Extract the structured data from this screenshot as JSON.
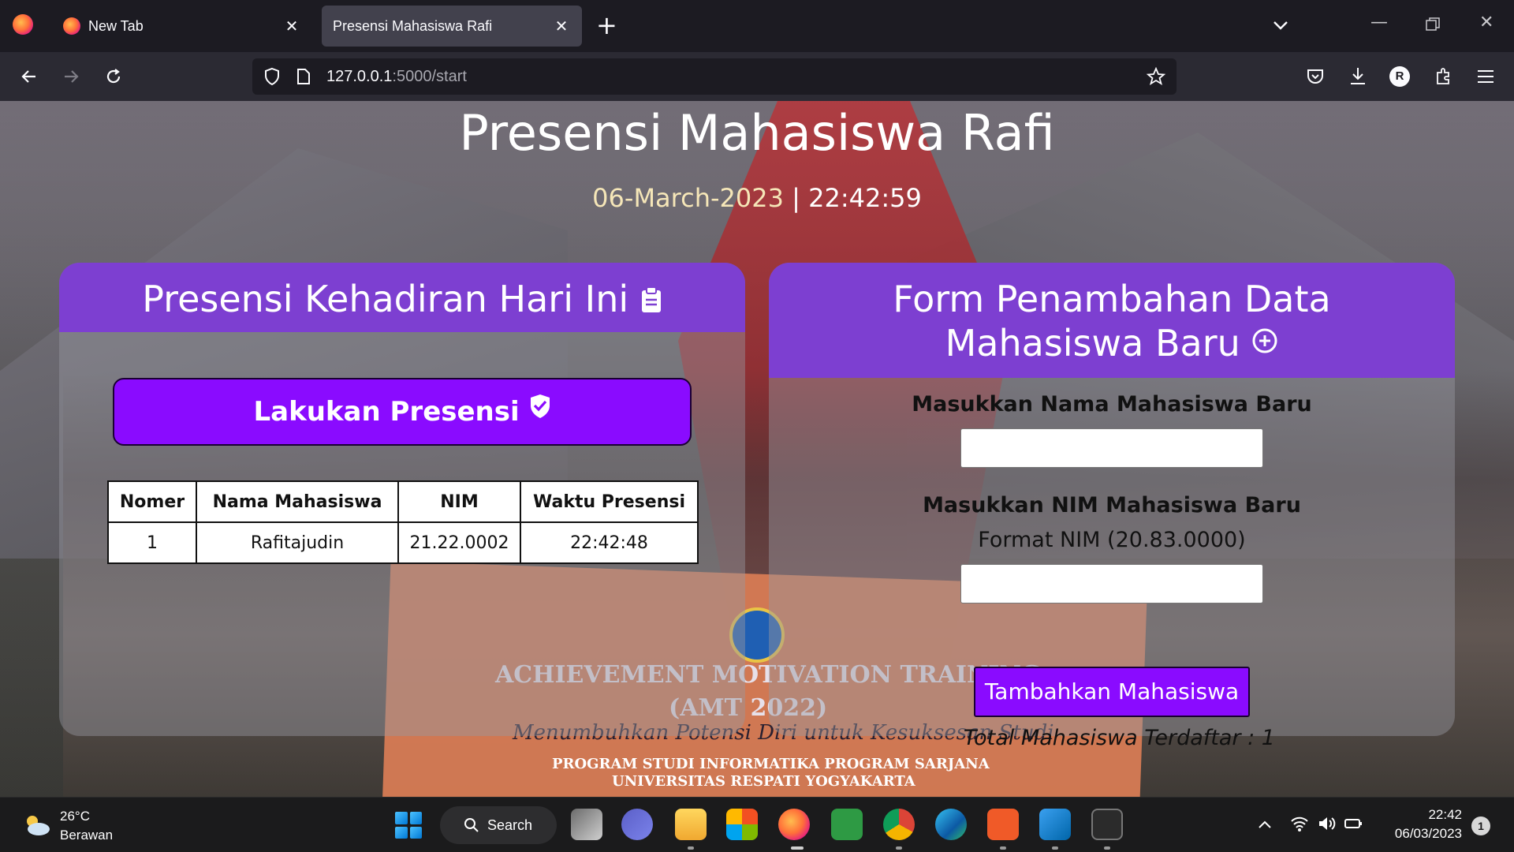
{
  "browser": {
    "tabs": [
      {
        "label": "New Tab",
        "active": false
      },
      {
        "label": "Presensi Mahasiswa Rafi",
        "active": true
      }
    ],
    "url_host": "127.0.0.1",
    "url_path": ":5000/start",
    "profile_initial": "R"
  },
  "page": {
    "title": "Presensi Mahasiswa Rafi",
    "date": "06-March-2023",
    "separator": " | ",
    "time": "22:42:59",
    "attendance_card": {
      "title": "Presensi Kehadiran Hari Ini",
      "button_label": "Lakukan Presensi",
      "columns": [
        "Nomer",
        "Nama Mahasiswa",
        "NIM",
        "Waktu Presensi"
      ],
      "rows": [
        [
          "1",
          "Rafitajudin",
          "21.22.0002",
          "22:42:48"
        ]
      ]
    },
    "form_card": {
      "title": "Form Penambahan Data Mahasiswa Baru",
      "name_label": "Masukkan Nama Mahasiswa Baru",
      "nim_label": "Masukkan NIM Mahasiswa Baru",
      "nim_hint": "Format NIM (20.83.0000)",
      "name_value": "",
      "nim_value": "",
      "submit_label": "Tambahkan Mahasiswa"
    },
    "total_text": "Total Mahasiswa Terdaftar : 1",
    "background_banner": {
      "line1": "ACHIEVEMENT MOTIVATION TRAINING",
      "line2": "(AMT 2022)",
      "line3": "Menumbuhkan Potensi Diri untuk Kesuksesan Studi",
      "line4": "PROGRAM STUDI INFORMATIKA PROGRAM SARJANA",
      "line5": "UNIVERSITAS RESPATI YOGYAKARTA"
    }
  },
  "taskbar": {
    "temperature": "26°C",
    "weather": "Berawan",
    "search_label": "Search",
    "time": "22:42",
    "date": "06/03/2023",
    "notification_count": "1"
  },
  "colors": {
    "accent_purple": "#7d3fd1",
    "button_purple": "#8a0bff",
    "date_color": "#f5e6b8"
  }
}
